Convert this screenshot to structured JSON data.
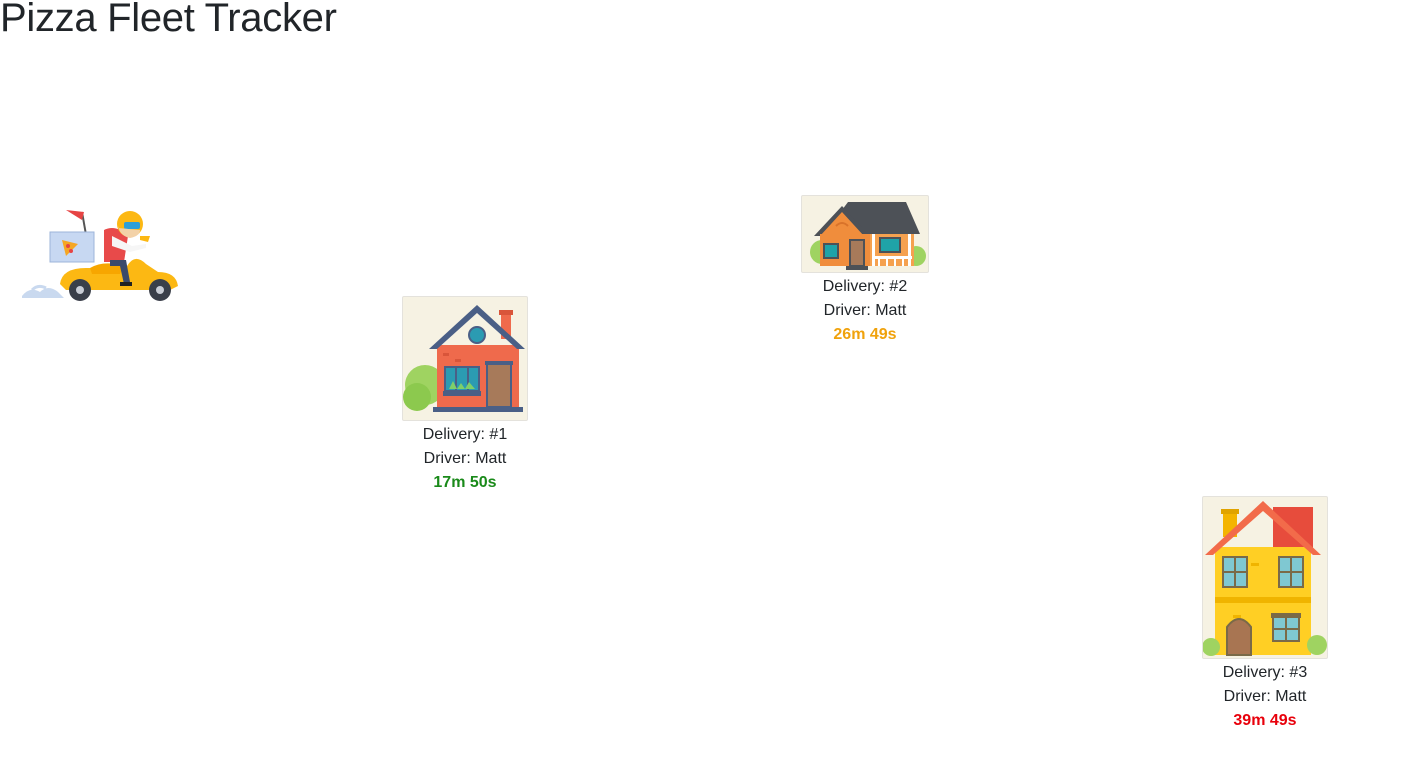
{
  "app": {
    "title": "Pizza Fleet Tracker"
  },
  "vehicle": {
    "icon": "delivery-scooter-icon"
  },
  "deliveries": [
    {
      "label": "Delivery: #1",
      "driver": "Driver: Matt",
      "eta": "17m 50s",
      "eta_color": "#1a8a1a",
      "house_icon": "red-house-icon"
    },
    {
      "label": "Delivery: #2",
      "driver": "Driver: Matt",
      "eta": "26m 49s",
      "eta_color": "#f0a20c",
      "house_icon": "orange-bungalow-icon"
    },
    {
      "label": "Delivery: #3",
      "driver": "Driver: Matt",
      "eta": "39m 49s",
      "eta_color": "#e8000b",
      "house_icon": "yellow-house-icon"
    }
  ]
}
